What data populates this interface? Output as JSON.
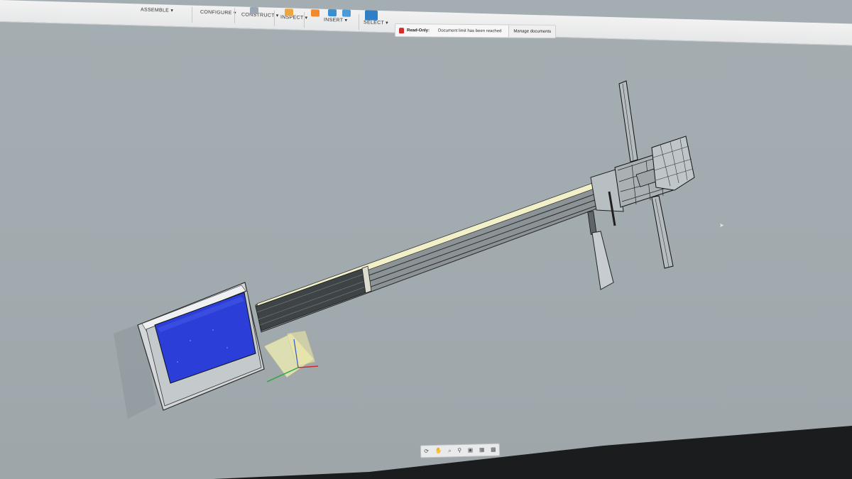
{
  "toolbar": {
    "groups": [
      {
        "label": "ASSEMBLE ▾"
      },
      {
        "label": "CONFIGURE ▾"
      },
      {
        "label": "CONSTRUCT ▾"
      },
      {
        "label": "INSPECT ▾"
      },
      {
        "label": "INSERT ▾"
      },
      {
        "label": "SELECT ▾"
      }
    ]
  },
  "notice": {
    "title": "Read-Only:",
    "message": "Document limit has been reached",
    "action": "Manage documents"
  },
  "navbar": {
    "icons": [
      "orbit-icon",
      "pan-icon",
      "zoom-icon",
      "fit-icon",
      "display-icon",
      "grid-icon",
      "viewport-icon"
    ]
  },
  "colors": {
    "canvas": "#a3acb0",
    "screen_blue": "#2b3fd8",
    "lock_red": "#d0302b",
    "sketch_yellow": "#f2f0b4"
  }
}
